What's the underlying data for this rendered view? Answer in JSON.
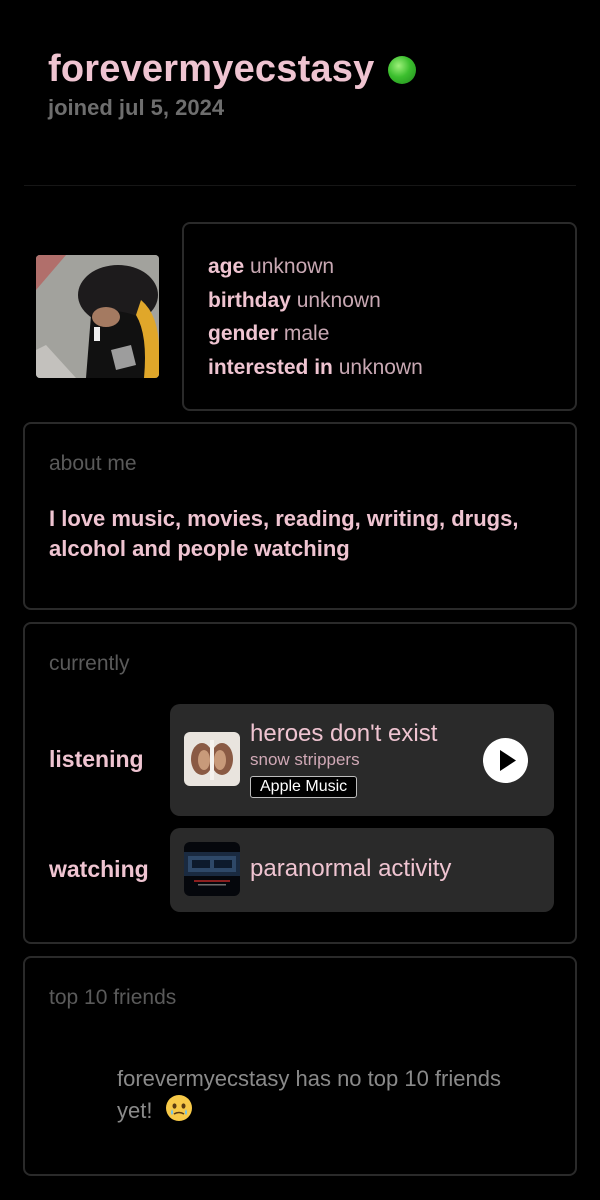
{
  "profile": {
    "username": "forevermyecstasy",
    "joined": "joined jul 5, 2024",
    "status_color": "#3cbf2e"
  },
  "info": {
    "age_key": "age",
    "age_value": "unknown",
    "birthday_key": "birthday",
    "birthday_value": "unknown",
    "gender_key": "gender",
    "gender_value": "male",
    "interested_key": "interested in",
    "interested_value": "unknown"
  },
  "about": {
    "title": "about me",
    "text": "I love music, movies, reading, writing, drugs, alcohol and people watching"
  },
  "currently": {
    "title": "currently",
    "listening_label": "listening",
    "track_title": "heroes don't exist",
    "track_artist": "snow strippers",
    "source_badge": "Apple Music",
    "watching_label": "watching",
    "watching_title": "paranormal activity"
  },
  "friends": {
    "title": "top 10 friends",
    "empty_text": "forevermyecstasy has no top 10 friends yet!"
  },
  "icons": {
    "status": "online-dot-icon",
    "play": "play-icon",
    "emoji": "face-holding-back-tears-emoji"
  },
  "colors": {
    "accent_pink": "#efc4d1",
    "muted_gray": "#5a5a5a",
    "card_border": "#2a2a2a",
    "media_bg": "#2a2a2a"
  }
}
